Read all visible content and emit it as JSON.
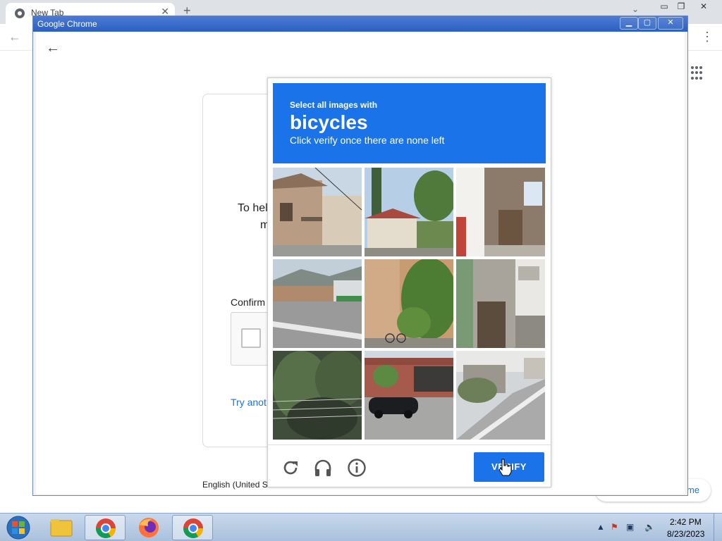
{
  "background_browser": {
    "tab_title": "New Tab",
    "customize_label": "me"
  },
  "popup": {
    "window_title": "Google Chrome",
    "signin": {
      "description_part1": "To hel",
      "description_part2": "m",
      "confirm_label": "Confirm",
      "try_another_label": "Try anot",
      "language_label": "English (United S"
    }
  },
  "captcha": {
    "instruction": "Select all images with",
    "target": "bicycles",
    "sub_instruction": "Click verify once there are none left",
    "tiles": [
      {
        "scene": "building with balcony and stairs"
      },
      {
        "scene": "red-roofed house with trees"
      },
      {
        "scene": "shop interior with poster"
      },
      {
        "scene": "road with shops and mountains"
      },
      {
        "scene": "wall with tree and bicycle"
      },
      {
        "scene": "building entrance with stairs"
      },
      {
        "scene": "tree behind power lines"
      },
      {
        "scene": "black car near train station"
      },
      {
        "scene": "sloped street with sidewalk"
      }
    ],
    "verify_label": "VERIFY",
    "accent_color": "#1a73e8"
  },
  "taskbar": {
    "time": "2:42 PM",
    "date": "8/23/2023",
    "apps": [
      "explorer-icon",
      "chrome-icon",
      "firefox-icon",
      "chrome-icon"
    ]
  }
}
